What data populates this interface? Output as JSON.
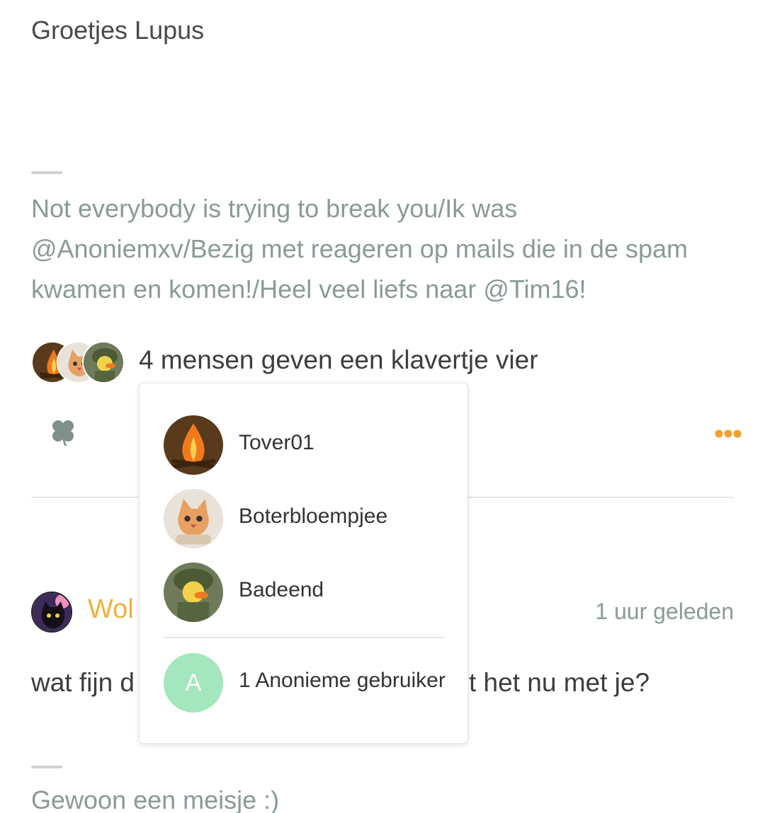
{
  "post": {
    "greeting": "Groetjes Lupus",
    "signature": "Not everybody is trying to break you/Ik was @Anoniemxv/Bezig met reageren op mails die in de spam kwamen en komen!/Heel veel liefs naar @Tim16!"
  },
  "likes": {
    "summary": "4 mensen geven een klavertje vier",
    "avatars": [
      "campfire-avatar",
      "kitten-avatar",
      "duck-soldier-avatar"
    ]
  },
  "actions": {
    "clover_icon": "clover-icon",
    "more_icon": "more-dots-icon",
    "more_color": "#f0a030"
  },
  "popup": {
    "users": [
      {
        "name": "Tover01",
        "avatar": "campfire-avatar"
      },
      {
        "name": "Boterbloempjee",
        "avatar": "kitten-avatar"
      },
      {
        "name": "Badeend",
        "avatar": "duck-soldier-avatar"
      }
    ],
    "anonymous": {
      "initial": "A",
      "label": "1 Anonieme gebruiker",
      "color": "#a4e6bd"
    }
  },
  "comment": {
    "username_visible": "Wol",
    "time": "1 uur geleden",
    "text_left": "wat fijn d",
    "text_right": "t het nu met je?",
    "signature": "Gewoon een meisje :)",
    "username_color": "#f0b13c"
  }
}
